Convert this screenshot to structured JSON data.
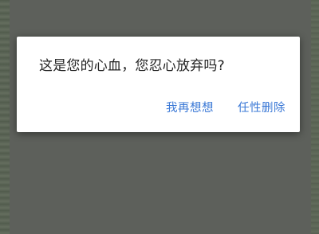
{
  "dialog": {
    "message": "这是您的心血，您忍心放弃吗?",
    "buttons": {
      "cancel_label": "我再想想",
      "delete_label": "任性删除"
    }
  },
  "colors": {
    "accent": "#3a78d6",
    "scrim": "#5d605b",
    "dialog_background": "#ffffff",
    "message_text": "#212121"
  }
}
